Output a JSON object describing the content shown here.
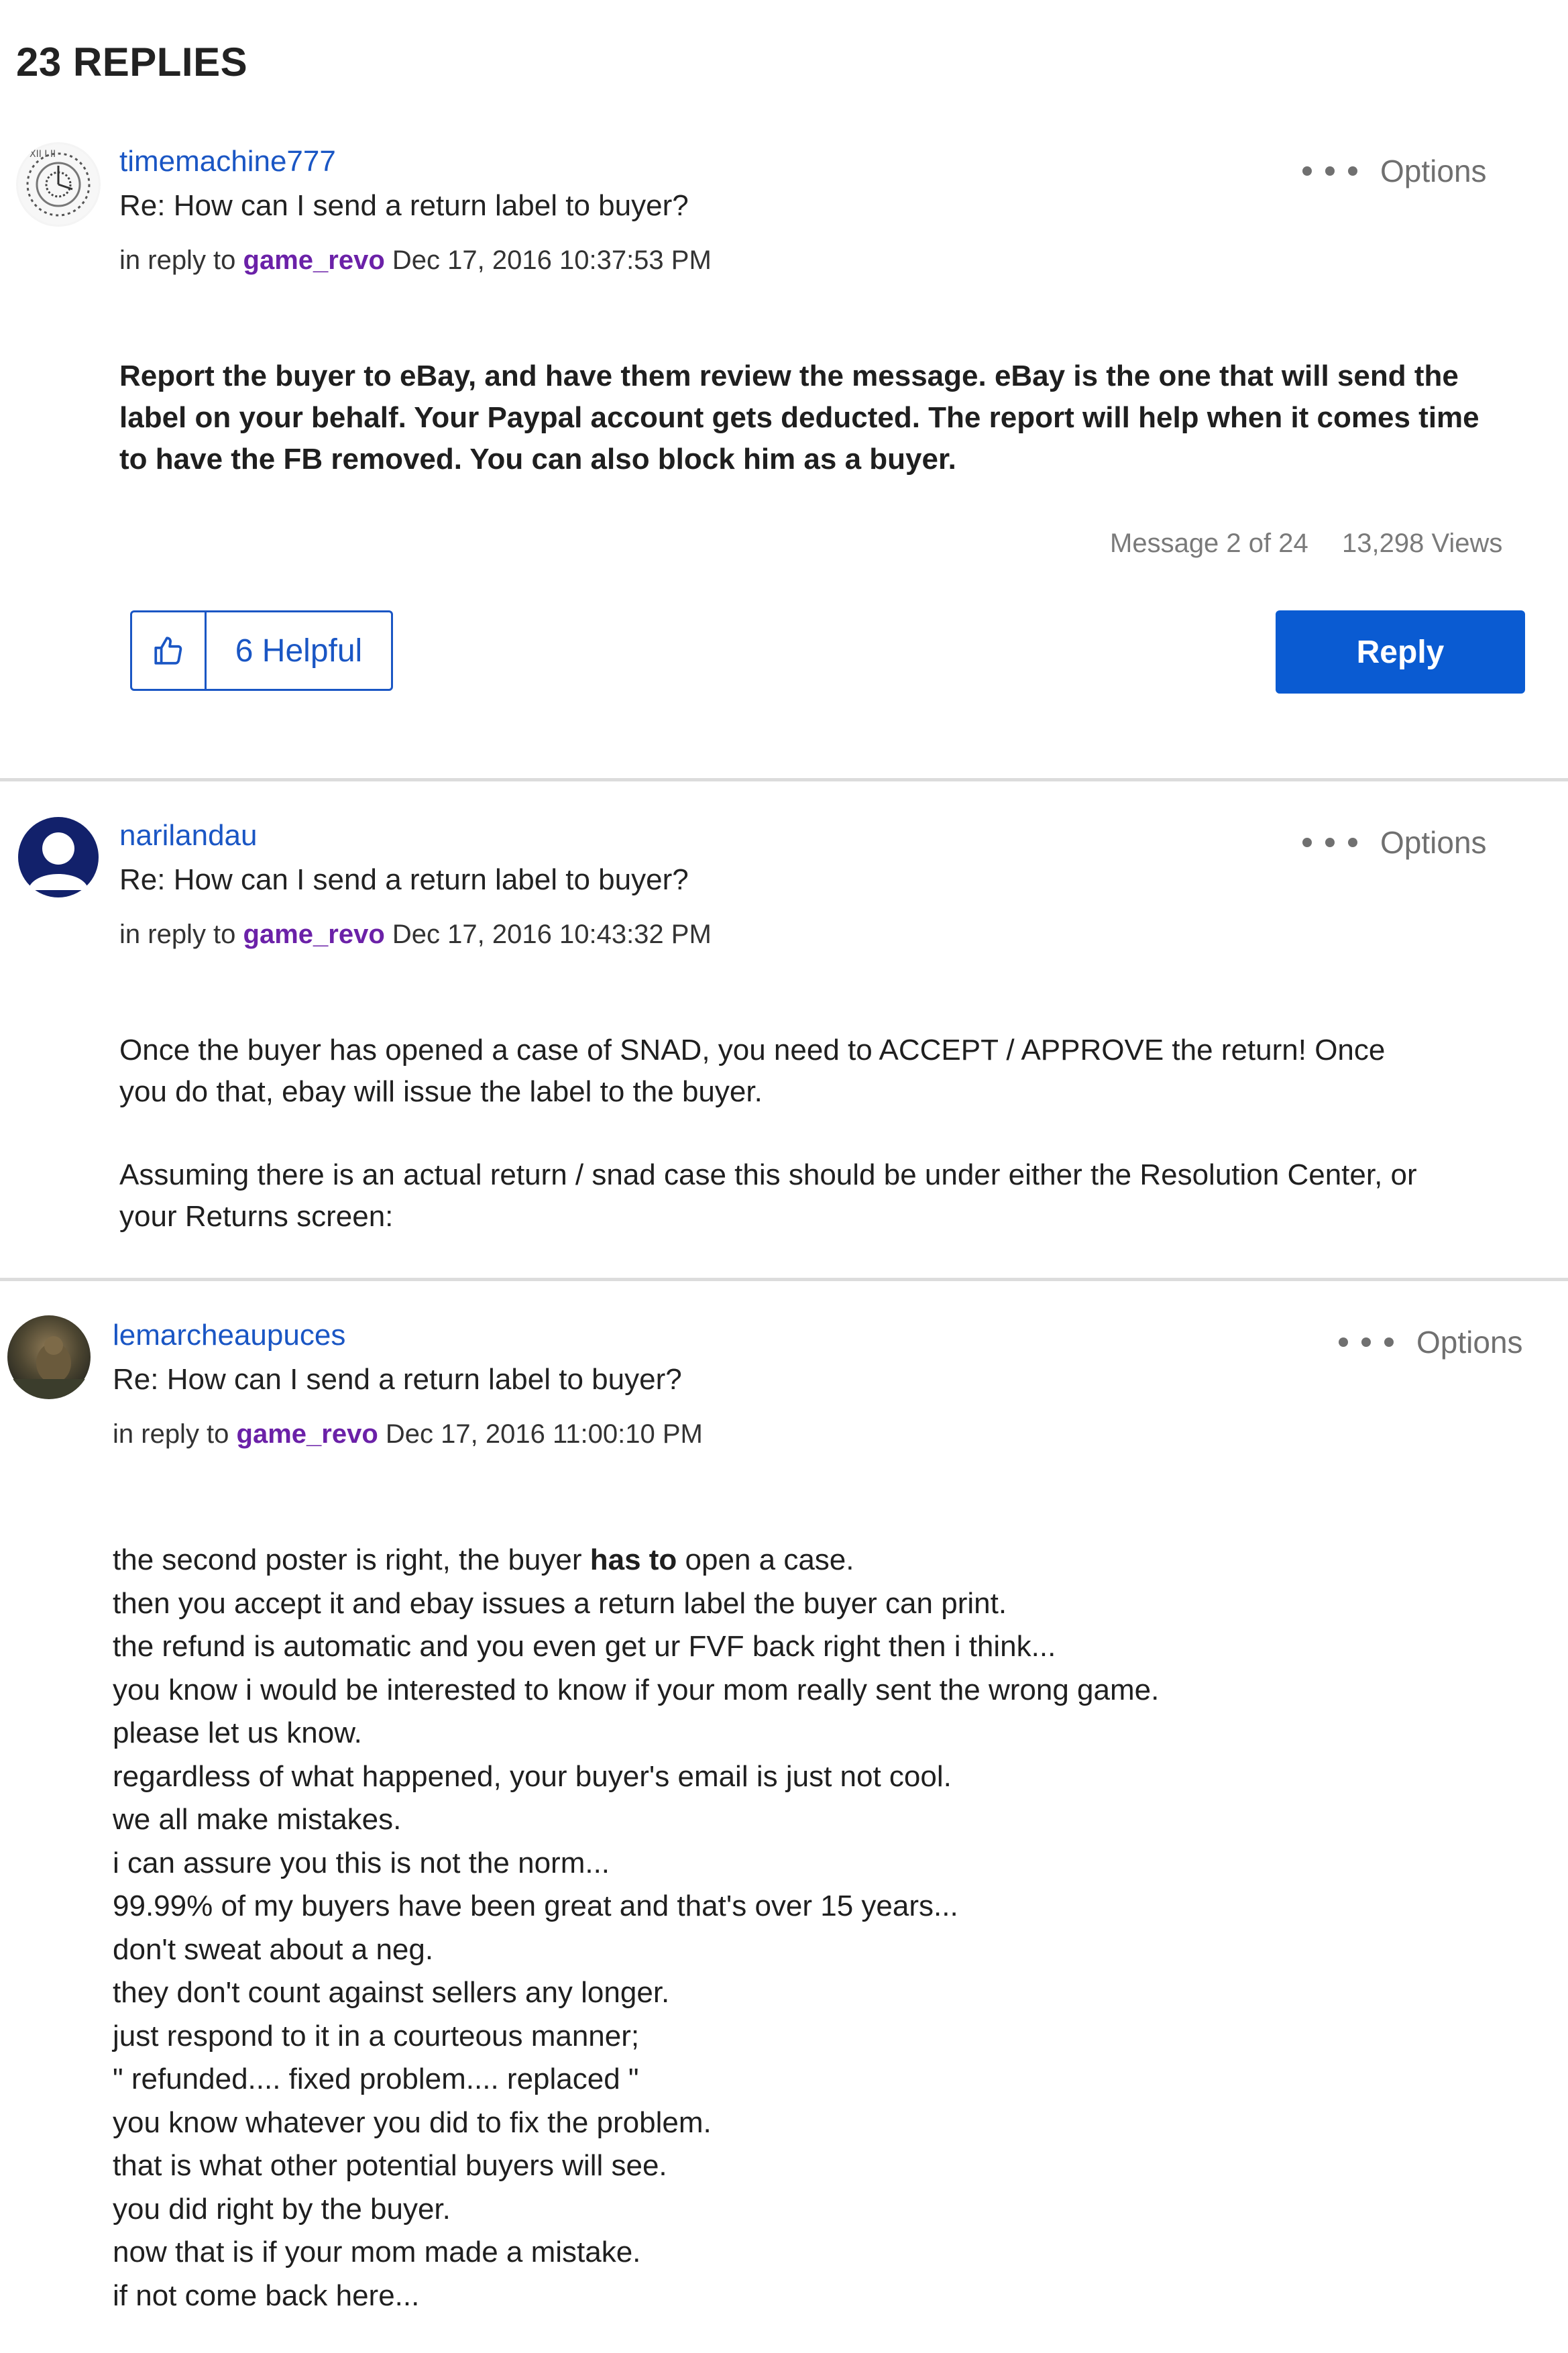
{
  "header": {
    "replies_title": "23 REPLIES"
  },
  "posts": [
    {
      "username": "timemachine777",
      "subject": "Re: How can I send a return label to buyer?",
      "in_reply_prefix": "in reply to",
      "reply_to_user": "game_revo",
      "timestamp": "Dec 17, 2016 10:37:53 PM",
      "options_label": "Options",
      "body": [
        "Report the buyer to eBay, and have them review the message. eBay is the one that will send the",
        "label on your behalf. Your Paypal account gets deducted. The report will help when it comes time",
        "to have the FB removed. You can also block him as a buyer."
      ],
      "message_position": "Message 2 of 24",
      "views": "13,298 Views",
      "helpful_label": "6 Helpful",
      "reply_label": "Reply"
    },
    {
      "username": "narilandau",
      "subject": "Re: How can I send a return label to buyer?",
      "in_reply_prefix": "in reply to",
      "reply_to_user": "game_revo",
      "timestamp": "Dec 17, 2016 10:43:32 PM",
      "options_label": "Options",
      "body": [
        "Once the buyer has opened a case of SNAD, you need to ACCEPT / APPROVE the return!  Once",
        "you do that, ebay will issue the label to the buyer.",
        "",
        "Assuming there is an actual return / snad case this should be under either the Resolution Center, or",
        "your Returns screen:"
      ]
    },
    {
      "username": "lemarcheaupuces",
      "subject": "Re: How can I send a return label to buyer?",
      "in_reply_prefix": "in reply to",
      "reply_to_user": "game_revo",
      "timestamp": "Dec 17, 2016 11:00:10 PM",
      "options_label": "Options",
      "body_first_line": {
        "before": "the second poster is right, the buyer ",
        "emphasis": "has to",
        "after": " open a case."
      },
      "body": [
        "then you accept it and ebay issues a return label the buyer can print.",
        "the refund is automatic and you even get ur FVF back right then i think...",
        "you know i would be interested to know if your mom really sent the wrong game.",
        "please let us know.",
        "regardless of what happened, your buyer's email is just not cool.",
        "we all make mistakes.",
        "i can assure you this is not the norm...",
        "99.99% of my buyers have been great and that's over 15 years...",
        "don't sweat about a neg.",
        "they don't count against sellers any longer.",
        "just respond to it in a courteous manner;",
        "\" refunded.... fixed problem.... replaced \"",
        "you know whatever you did to fix the problem.",
        "that is what other potential buyers will see.",
        "you did right by the buyer.",
        "now that is if your mom made a mistake.",
        "if not come back here..."
      ]
    }
  ],
  "icons": {
    "options": "more-dots-icon",
    "helpful": "thumbs-up-icon"
  },
  "colors": {
    "link": "#1a56c4",
    "reply_to": "#6b21a8",
    "primary_button": "#0a5bd2",
    "divider": "#dcdcdc"
  }
}
